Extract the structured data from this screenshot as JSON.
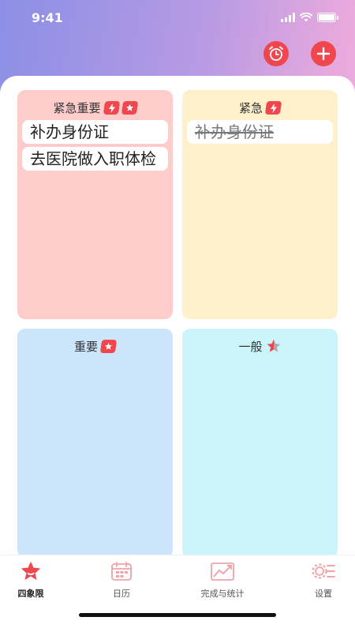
{
  "status_bar": {
    "time": "9:41"
  },
  "colors": {
    "accent": "#f0474f",
    "q_urgent_important": "#ffcccc",
    "q_urgent": "#fff0cc",
    "q_important": "#cce5fb",
    "q_normal": "#ccf4fb"
  },
  "top_actions": [
    {
      "icon": "alarm-clock-icon"
    },
    {
      "icon": "plus-icon"
    }
  ],
  "quadrants": {
    "urgent_important": {
      "title": "紧急重要",
      "tasks": [
        {
          "text": "补办身份证",
          "done": false
        },
        {
          "text": "去医院做入职体检",
          "done": false
        }
      ]
    },
    "urgent": {
      "title": "紧急",
      "tasks": [
        {
          "text": "补办身份证",
          "done": true
        }
      ]
    },
    "important": {
      "title": "重要",
      "tasks": []
    },
    "normal": {
      "title": "一般",
      "tasks": []
    }
  },
  "tabs": [
    {
      "label": "四象限",
      "icon": "star-icon",
      "active": true
    },
    {
      "label": "日历",
      "icon": "calendar-icon",
      "active": false
    },
    {
      "label": "完成与统计",
      "icon": "chart-icon",
      "active": false
    },
    {
      "label": "设置",
      "icon": "settings-icon",
      "active": false
    }
  ]
}
